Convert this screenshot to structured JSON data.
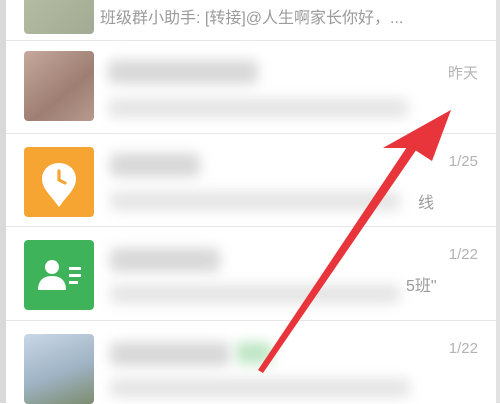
{
  "chats": [
    {
      "snippet": "班级群小助手: [转接]@人生啊家长你好，...",
      "time": ""
    },
    {
      "time": "昨天"
    },
    {
      "time": "1/25",
      "partial": "线"
    },
    {
      "time": "1/22",
      "partial": "5班\""
    },
    {
      "time": "1/22"
    }
  ],
  "colors": {
    "alarm_bg": "#f6a432",
    "contact_bg": "#3fb35a",
    "arrow": "#e8343b"
  },
  "icons": {
    "alarm": "clock-icon",
    "contact": "contact-card-icon"
  }
}
